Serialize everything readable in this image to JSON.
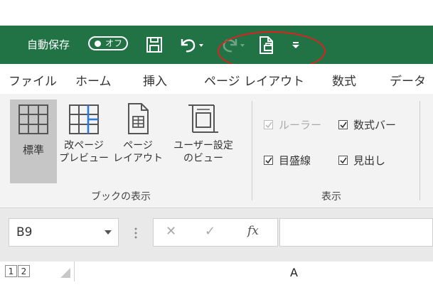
{
  "qat": {
    "autosave_label": "自動保存",
    "autosave_state": "オフ",
    "accent": "#217346"
  },
  "tabs": [
    "ファイル",
    "ホーム",
    "挿入",
    "ページ レイアウト",
    "数式",
    "データ"
  ],
  "ribbon": {
    "views": [
      {
        "label": "標準",
        "icon": "normal-view-icon",
        "selected": true
      },
      {
        "label": "改ページ\nプレビュー",
        "icon": "page-break-preview-icon",
        "selected": false
      },
      {
        "label": "ページ\nレイアウト",
        "icon": "page-layout-view-icon",
        "selected": false
      },
      {
        "label": "ユーザー設定\nのビュー",
        "icon": "custom-views-icon",
        "selected": false
      }
    ],
    "views_group_label": "ブックの表示",
    "show": [
      {
        "label": "ルーラー",
        "checked": true,
        "disabled": true
      },
      {
        "label": "数式バー",
        "checked": true,
        "disabled": false
      },
      {
        "label": "目盛線",
        "checked": true,
        "disabled": false
      },
      {
        "label": "見出し",
        "checked": true,
        "disabled": false
      }
    ],
    "show_group_label": "表示"
  },
  "formula_bar": {
    "name_box": "B9",
    "cancel": "✕",
    "enter": "✓",
    "fx": "fx",
    "value": ""
  },
  "grid": {
    "outline_levels": [
      "1",
      "2"
    ],
    "column_header": "A"
  }
}
